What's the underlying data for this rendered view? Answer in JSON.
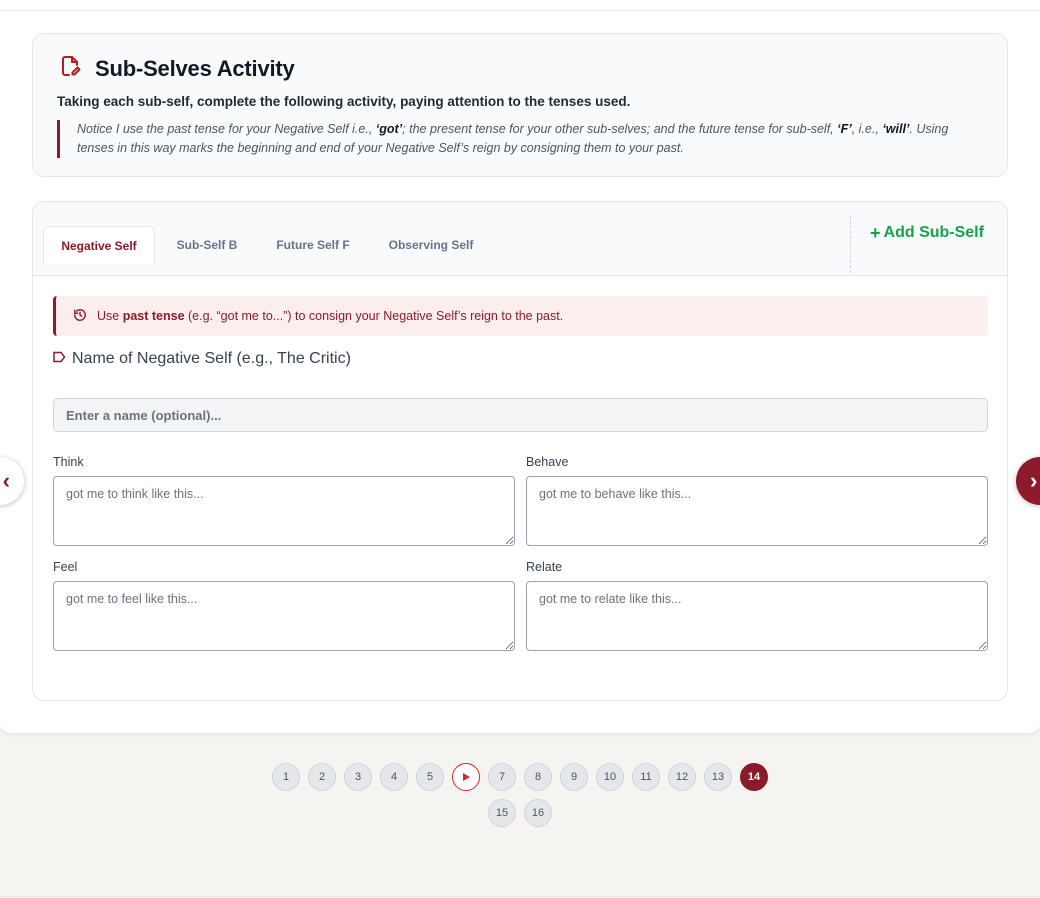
{
  "intro": {
    "title": "Sub-Selves Activity",
    "subtitle": "Taking each sub-self, complete the following activity, paying attention to the tenses used.",
    "quote_parts": {
      "p1": "Notice I use the past tense for your Negative Self i.e., ",
      "b1": "‘got’",
      "p2": "; the present tense for your other sub-selves; and the future tense for sub-self, ",
      "b2": "‘F’",
      "p3": ", i.e., ",
      "b3": "‘will’",
      "p4": ". Using tenses in this way marks the beginning and end of your Negative Self’s reign by consigning them to your past."
    }
  },
  "tabs": [
    {
      "label": "Negative Self",
      "active": true
    },
    {
      "label": "Sub-Self B",
      "active": false
    },
    {
      "label": "Future Self F",
      "active": false
    },
    {
      "label": "Observing Self",
      "active": false
    }
  ],
  "add_button": "Add Sub-Self",
  "alert": {
    "pre": "Use ",
    "bold": "past tense",
    "post": " (e.g. “got me to...”) to consign your Negative Self’s reign to the past."
  },
  "name_label": "Name of Negative Self (e.g., The Critic)",
  "name_input": {
    "placeholder": "Enter a name (optional)...",
    "value": ""
  },
  "fields": [
    {
      "label": "Think",
      "placeholder": "got me to think like this..."
    },
    {
      "label": "Behave",
      "placeholder": "got me to behave like this..."
    },
    {
      "label": "Feel",
      "placeholder": "got me to feel like this..."
    },
    {
      "label": "Relate",
      "placeholder": "got me to relate like this..."
    }
  ],
  "pagination": {
    "pages": [
      "1",
      "2",
      "3",
      "4",
      "5",
      "6",
      "7",
      "8",
      "9",
      "10",
      "11",
      "12",
      "13",
      "14",
      "15",
      "16"
    ],
    "current": "14",
    "playing": "6"
  },
  "colors": {
    "accent": "#8b1a2b",
    "add": "#16a34a",
    "alert_bg": "#fdeeee"
  }
}
